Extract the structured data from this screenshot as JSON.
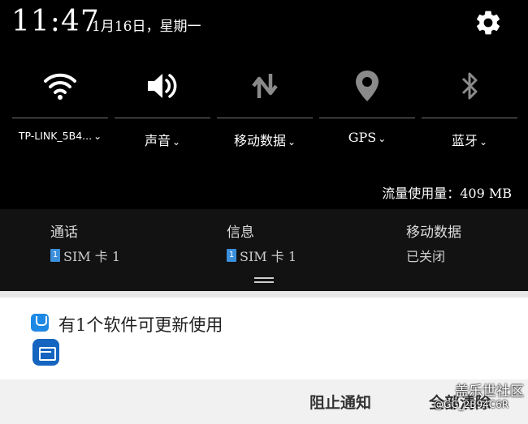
{
  "status": {
    "time": "11:47",
    "date": "1月16日，星期一"
  },
  "quick_settings": [
    {
      "label": "TP-LINK_5B4...",
      "icon": "wifi-icon",
      "active": true
    },
    {
      "label": "声音",
      "icon": "volume-icon",
      "active": true
    },
    {
      "label": "移动数据",
      "icon": "mobile-data-icon",
      "active": false
    },
    {
      "label": "GPS",
      "icon": "location-icon",
      "active": false
    },
    {
      "label": "蓝牙",
      "icon": "bluetooth-icon",
      "active": false
    }
  ],
  "data_usage": "流量使用量：409 MB",
  "sim": [
    {
      "title": "通话",
      "value": "SIM 卡 1",
      "badge": "1"
    },
    {
      "title": "信息",
      "value": "SIM 卡 1",
      "badge": "1"
    },
    {
      "title": "移动数据",
      "value": "已关闭"
    }
  ],
  "notification": {
    "title": "有1个软件可更新使用"
  },
  "actions": {
    "block": "阻止通知",
    "clear": "全部清除"
  },
  "watermark": {
    "line1": "盖乐世社区",
    "line2": "@GG_2B94C6R"
  },
  "colors": {
    "accent": "#1e88e5",
    "inactive_icon": "#8a8a8a"
  }
}
